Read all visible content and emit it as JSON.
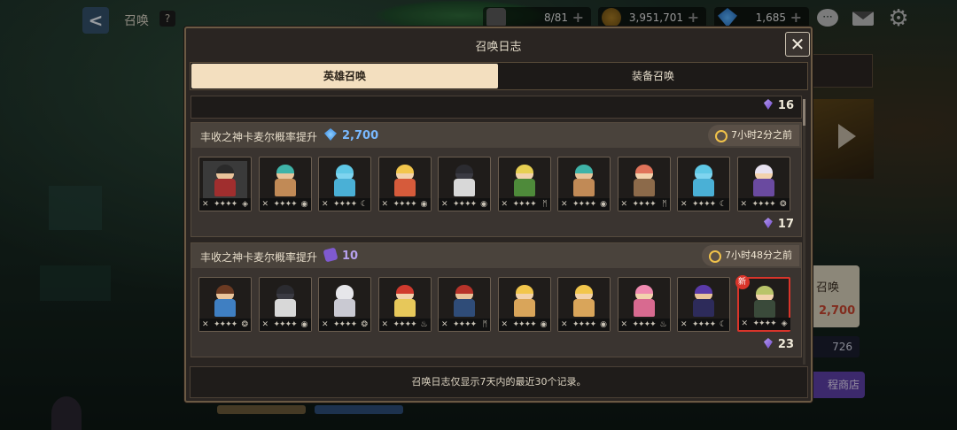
{
  "hud": {
    "title": "召唤",
    "help": "?",
    "back": "<",
    "stamina": "8/81",
    "gold": "3,951,701",
    "gems": "1,685",
    "plus": "+"
  },
  "side": {
    "card_text": "召唤",
    "card_price": "2,700",
    "count": "726",
    "shop": "程商店"
  },
  "modal": {
    "title": "召唤日志",
    "close": "✕",
    "tabs": [
      {
        "label": "英雄召唤",
        "active": true
      },
      {
        "label": "装备召唤",
        "active": false
      }
    ],
    "top_qty": "16",
    "entries": [
      {
        "title": "丰收之神卡麦尔概率提升",
        "cost_type": "diamond",
        "cost": "2,700",
        "time": "7小时2分之前",
        "foot_qty": "17",
        "cards": [
          {
            "hair": "#2a2a2a",
            "skin": "#e9c49b",
            "body": "#a02e2e",
            "bg": "#3a3a3a",
            "stars": "✦✦✦✦",
            "elem": "◈"
          },
          {
            "hair": "#3fb3a8",
            "skin": "#e9c49b",
            "body": "#c18a56",
            "bg": "#1f1c1a",
            "stars": "✦✦✦✦",
            "elem": "◉"
          },
          {
            "hair": "#5fc8e6",
            "skin": "#7fd4ef",
            "body": "#4ab0d6",
            "bg": "#1f1c1a",
            "stars": "✦✦✦✦",
            "elem": "☾"
          },
          {
            "hair": "#f2c64c",
            "skin": "#f2d2ad",
            "body": "#d65b3b",
            "bg": "#1f1c1a",
            "stars": "✦✦✦✦",
            "elem": "◉"
          },
          {
            "hair": "#2b2b30",
            "skin": "#3a3a42",
            "body": "#d8d8d8",
            "bg": "#1f1c1a",
            "stars": "✦✦✦✦",
            "elem": "◉"
          },
          {
            "hair": "#e7cf52",
            "skin": "#f2d2ad",
            "body": "#4e8a3a",
            "bg": "#1f1c1a",
            "stars": "✦✦✦✦",
            "elem": "ᛗ"
          },
          {
            "hair": "#3fb3a8",
            "skin": "#e9c49b",
            "body": "#c18a56",
            "bg": "#1f1c1a",
            "stars": "✦✦✦✦",
            "elem": "◉"
          },
          {
            "hair": "#e0735a",
            "skin": "#f2d2ad",
            "body": "#8c6a4a",
            "bg": "#1f1c1a",
            "stars": "✦✦✦✦",
            "elem": "ᛗ"
          },
          {
            "hair": "#5fc8e6",
            "skin": "#7fd4ef",
            "body": "#4ab0d6",
            "bg": "#1f1c1a",
            "stars": "✦✦✦✦",
            "elem": "☾"
          },
          {
            "hair": "#e8e2f0",
            "skin": "#f2d2ad",
            "body": "#6a4aa0",
            "bg": "#1f1c1a",
            "stars": "✦✦✦✦",
            "elem": "❂"
          }
        ]
      },
      {
        "title": "丰收之神卡麦尔概率提升",
        "cost_type": "ticket",
        "cost": "10",
        "time": "7小时48分之前",
        "foot_qty": "23",
        "cards": [
          {
            "hair": "#6b3a22",
            "skin": "#e9c49b",
            "body": "#3f7fc2",
            "bg": "#1f1c1a",
            "stars": "✦✦✦✦",
            "elem": "❂"
          },
          {
            "hair": "#2b2b30",
            "skin": "#3a3a42",
            "body": "#d8d8d8",
            "bg": "#1f1c1a",
            "stars": "✦✦✦✦",
            "elem": "◉"
          },
          {
            "hair": "#e6e6ea",
            "skin": "#e6e6ea",
            "body": "#c9c9d2",
            "bg": "#1f1c1a",
            "stars": "✦✦✦✦",
            "elem": "❂"
          },
          {
            "hair": "#d03a2e",
            "skin": "#f2d2ad",
            "body": "#e7c85a",
            "bg": "#1f1c1a",
            "stars": "✦✦✦✦",
            "elem": "♨"
          },
          {
            "hair": "#b7332a",
            "skin": "#e9c49b",
            "body": "#2f4c78",
            "bg": "#1f1c1a",
            "stars": "✦✦✦✦",
            "elem": "ᛗ"
          },
          {
            "hair": "#f2c64c",
            "skin": "#f2d2ad",
            "body": "#d9a55a",
            "bg": "#1f1c1a",
            "stars": "✦✦✦✦",
            "elem": "◉"
          },
          {
            "hair": "#f2c64c",
            "skin": "#f2d2ad",
            "body": "#d9a55a",
            "bg": "#1f1c1a",
            "stars": "✦✦✦✦",
            "elem": "◉"
          },
          {
            "hair": "#f08ab0",
            "skin": "#f2d2ad",
            "body": "#d86a90",
            "bg": "#1f1c1a",
            "stars": "✦✦✦✦",
            "elem": "♨"
          },
          {
            "hair": "#5a3aa8",
            "skin": "#e9c49b",
            "body": "#2d2b5a",
            "bg": "#1f1c1a",
            "stars": "✦✦✦✦",
            "elem": "☾"
          },
          {
            "hair": "#b9c46a",
            "skin": "#f2d2ad",
            "body": "#3a4a3a",
            "bg": "#1f1c1a",
            "stars": "✦✦✦✦",
            "elem": "◈",
            "new": "新",
            "highlight": true
          }
        ]
      }
    ],
    "footer": "召唤日志仅显示7天内的最近30个记录。"
  }
}
